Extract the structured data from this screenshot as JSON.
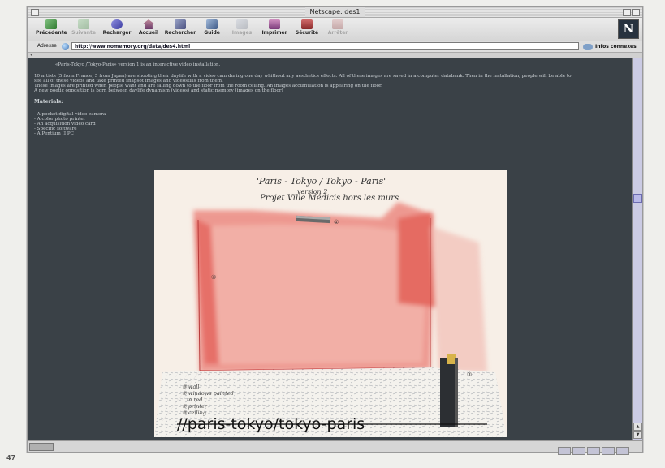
{
  "window": {
    "title": "Netscape: des1"
  },
  "toolbar": {
    "buttons": [
      {
        "label": "Précédente",
        "enabled": true
      },
      {
        "label": "Suivante",
        "enabled": false
      },
      {
        "label": "Recharger",
        "enabled": true
      },
      {
        "label": "Accueil",
        "enabled": true
      },
      {
        "label": "Rechercher",
        "enabled": true
      },
      {
        "label": "Guide",
        "enabled": true
      },
      {
        "label": "Images",
        "enabled": false
      },
      {
        "label": "Imprimer",
        "enabled": true
      },
      {
        "label": "Sécurité",
        "enabled": true
      },
      {
        "label": "Arrêter",
        "enabled": false
      }
    ],
    "logo": "N"
  },
  "address": {
    "label": "Adresse",
    "url": "http://www.nomemory.org/data/des4.html",
    "info_label": "Infos connexes"
  },
  "page": {
    "intro": "«Paris-Tokyo /Tokyo-Paris» version 1 is an interactive video installation.",
    "paragraph1": "10 artists (5 from France, 5 from Japan) are shooting their daylife with a video cam during one day whithout any aesthetics effects. All of these images are saved in a computer databank. Then in the installation, people will be able to",
    "paragraph1b": "see all of these videos and take printed snapsot images and videostills from them.",
    "paragraph2": "These images are printed when people want and are falling down to the floor from the room ceiling. An images accumulation is appearing on the floor.",
    "paragraph3": "A new poetic opposition is born between daylife dynamism (videos) and static memory (images on the floor)",
    "materials_heading": "Materials:",
    "materials": [
      "- A pocket digital video camera",
      "- A color photo printer",
      "- An acquisition video card",
      "- Specific software",
      "- A Pentium II PC"
    ]
  },
  "sketch": {
    "title_line1": "'Paris - Tokyo / Tokyo - Paris'",
    "title_version": "version 2",
    "title_line2": "Projet Ville Médicis hors les murs",
    "mark1": "①",
    "mark2": "②",
    "mark3": "③",
    "notes": [
      "③ wall",
      "② windows painted",
      "in red",
      "② printer",
      "③ ceiling"
    ]
  },
  "caption": "//paris-tokyo/tokyo-paris",
  "page_number": "47",
  "colors": {
    "background": "#3a4147",
    "text": "#cdd2d6",
    "red_wash": "#e45a52"
  }
}
